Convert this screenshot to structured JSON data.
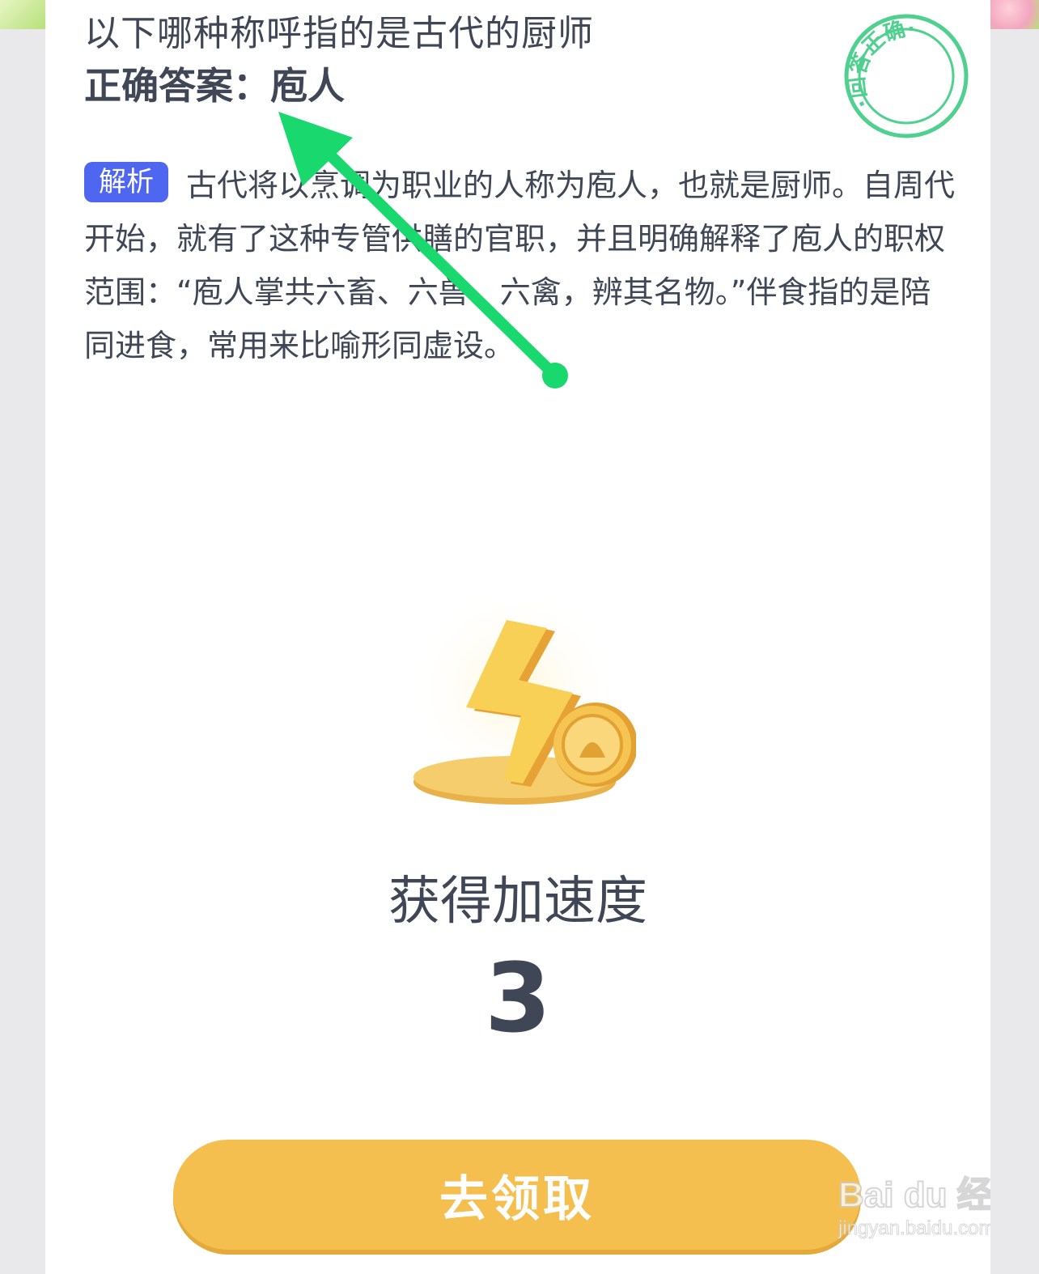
{
  "question": {
    "text": "以下哪种称呼指的是古代的厨师"
  },
  "answer": {
    "label": "正确答案：",
    "value": "庖人"
  },
  "stamp": {
    "text": "·回答正确·",
    "color": "#4fd08f"
  },
  "analysis": {
    "tag": "解析",
    "text": "古代将以烹调为职业的人称为庖人，也就是厨师。自周代开始，就有了这种专管供膳的官职，并且明确解释了庖人的职权范围：“庖人掌共六畜、六兽、六禽，辨其名物。”伴食指的是陪同进食，常用来比喻形同虚设。"
  },
  "reward": {
    "icon": "lightning-coin-icon",
    "title": "获得加速度",
    "value": "3"
  },
  "claim_button": {
    "label": "去领取",
    "color": "#f4bf4e"
  },
  "annotation": {
    "icon": "green-arrow-icon",
    "color": "#18d86e"
  },
  "watermark": {
    "brand": "Bai du 经验",
    "url": "jingyan.baidu.com"
  }
}
